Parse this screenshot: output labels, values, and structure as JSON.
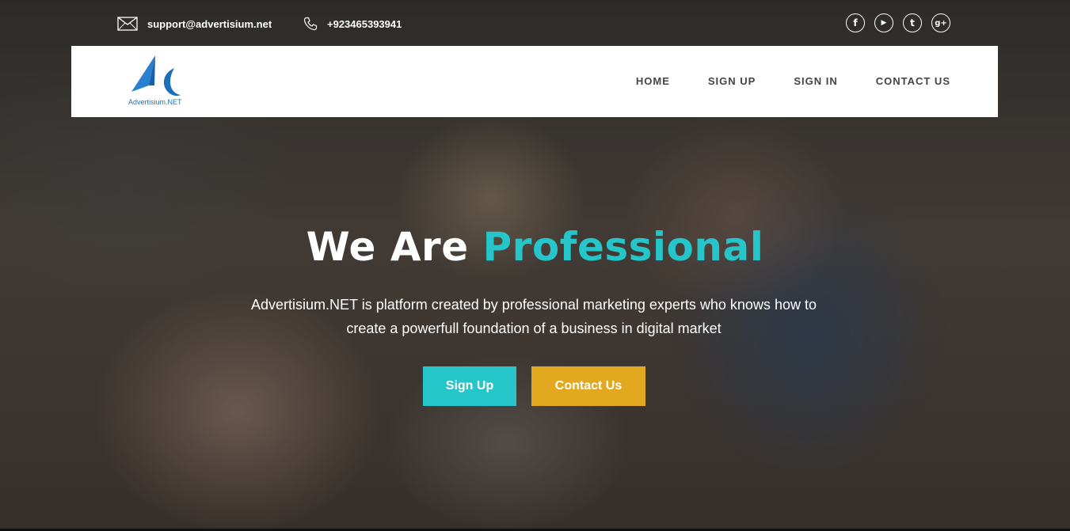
{
  "top_bar": {
    "email": "support@advertisium.net",
    "phone": "+923465393941",
    "socials": [
      {
        "icon": "facebook-icon",
        "glyph": "f"
      },
      {
        "icon": "youtube-icon",
        "glyph": "▶"
      },
      {
        "icon": "twitter-icon",
        "glyph": "t"
      },
      {
        "icon": "google-plus-icon",
        "glyph": "g+"
      }
    ]
  },
  "brand": {
    "logo_text": "Advertisium.NET"
  },
  "nav": {
    "home": "HOME",
    "sign_up": "SIGN UP",
    "sign_in": "SIGN IN",
    "contact_us": "CONTACT US"
  },
  "hero": {
    "title_prefix": "We Are ",
    "title_accent": "Professional",
    "description": "Advertisium.NET is platform created by professional marketing experts who knows how to create a powerfull foundation of a business in digital market",
    "primary_button": "Sign Up",
    "secondary_button": "Contact Us"
  },
  "colors": {
    "accent_teal": "#25c5c9",
    "accent_gold": "#e2a820",
    "brand_blue": "#1e6fb8"
  }
}
